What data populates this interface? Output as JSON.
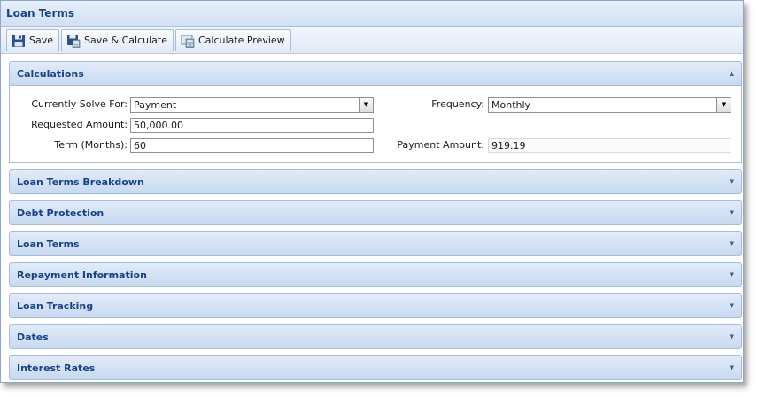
{
  "window": {
    "title": "Loan Terms"
  },
  "toolbar": {
    "save_label": "Save",
    "save_calc_label": "Save & Calculate",
    "calc_preview_label": "Calculate Preview"
  },
  "calculations": {
    "header": "Calculations",
    "solve_for_label": "Currently Solve For:",
    "solve_for_value": "Payment",
    "requested_amount_label": "Requested Amount:",
    "requested_amount_value": "50,000.00",
    "term_label": "Term (Months):",
    "term_value": "60",
    "frequency_label": "Frequency:",
    "frequency_value": "Monthly",
    "payment_amount_label": "Payment Amount:",
    "payment_amount_value": "919.19"
  },
  "panels": [
    "Loan Terms Breakdown",
    "Debt Protection",
    "Loan Terms",
    "Repayment Information",
    "Loan Tracking",
    "Dates",
    "Interest Rates"
  ],
  "colors": {
    "header_text": "#15428b",
    "panel_border": "#a3bde0"
  },
  "icons": {
    "save": "floppy-disk-icon",
    "save_calc": "floppy-calculator-icon",
    "preview": "calculator-preview-icon"
  }
}
